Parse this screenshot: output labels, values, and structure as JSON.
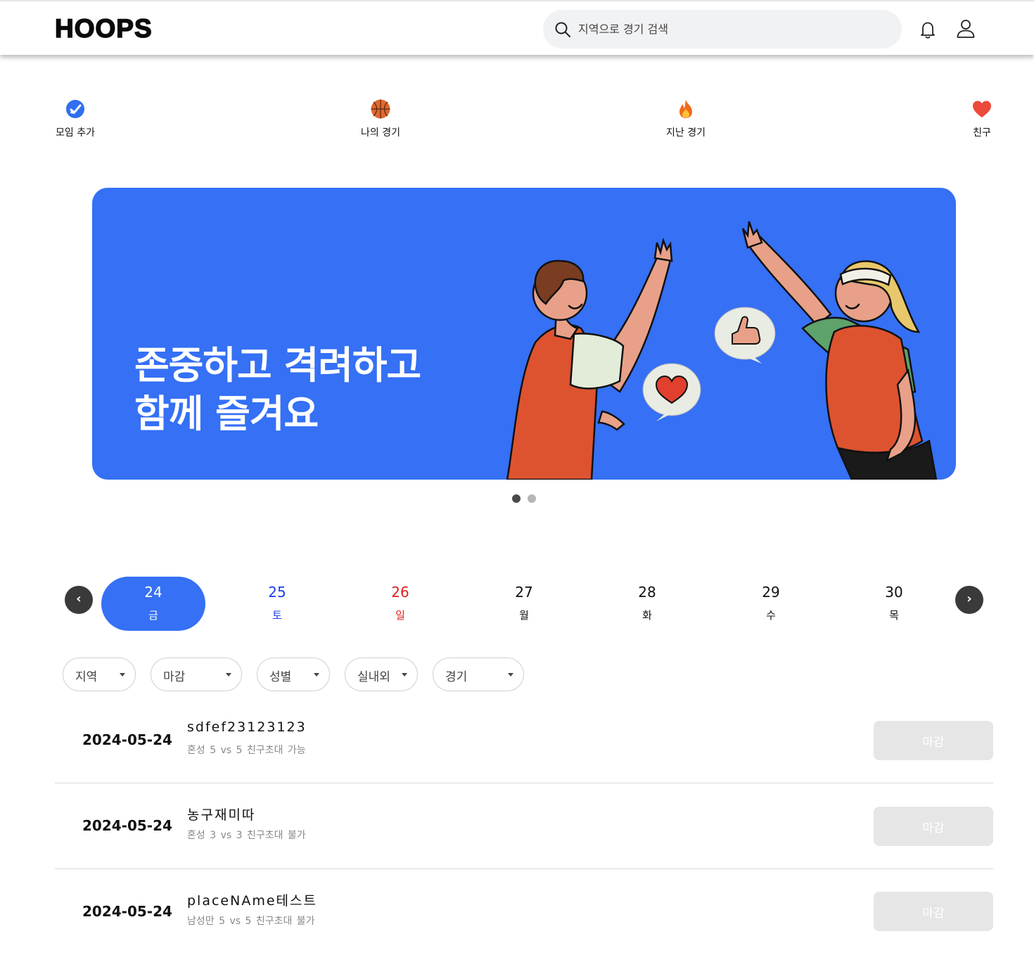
{
  "header": {
    "logo": "HOOPS",
    "search_placeholder": "지역으로 경기 검색"
  },
  "quick_menu": [
    {
      "label": "모임 추가",
      "icon": "add-meeting-icon"
    },
    {
      "label": "나의 경기",
      "icon": "basketball-icon"
    },
    {
      "label": "지난 경기",
      "icon": "fire-icon"
    },
    {
      "label": "친구",
      "icon": "heart-icon"
    }
  ],
  "banner": {
    "line1": "존중하고 격려하고",
    "line2": "함께 즐겨요",
    "background": "#3570f5",
    "slides": 2,
    "active_slide": 1
  },
  "dates": [
    {
      "num": "24",
      "wd": "금",
      "color": "#ffffff",
      "active": true
    },
    {
      "num": "25",
      "wd": "토",
      "color": "#1a3cf0"
    },
    {
      "num": "26",
      "wd": "일",
      "color": "#e02020"
    },
    {
      "num": "27",
      "wd": "월",
      "color": "#111111"
    },
    {
      "num": "28",
      "wd": "화",
      "color": "#111111"
    },
    {
      "num": "29",
      "wd": "수",
      "color": "#111111"
    },
    {
      "num": "30",
      "wd": "목",
      "color": "#111111"
    }
  ],
  "date_nav": {
    "prev": "‹",
    "next": "›"
  },
  "filters": [
    {
      "label": "지역"
    },
    {
      "label": "마감"
    },
    {
      "label": "성별"
    },
    {
      "label": "실내외"
    },
    {
      "label": "경기"
    }
  ],
  "games": [
    {
      "date": "2024-05-24",
      "title": "sdfef23123123",
      "meta": "혼성  5 vs 5  친구초대 가능",
      "button": "마감"
    },
    {
      "date": "2024-05-24",
      "title": "농구재미따",
      "meta": "혼성  3 vs 3  친구초대 불가",
      "button": "마감"
    },
    {
      "date": "2024-05-24",
      "title": "placeNAme테스트",
      "meta": "남성만  5 vs 5  친구초대 불가",
      "button": "마감"
    }
  ]
}
